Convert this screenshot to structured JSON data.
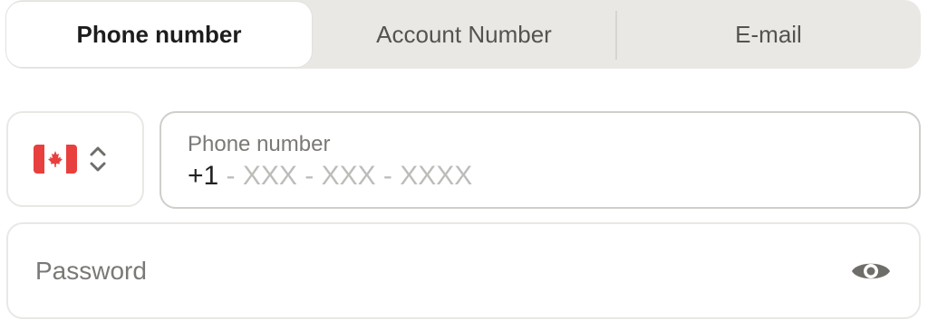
{
  "tabs": {
    "items": [
      {
        "label": "Phone number",
        "active": true
      },
      {
        "label": "Account Number",
        "active": false
      },
      {
        "label": "E-mail",
        "active": false
      }
    ]
  },
  "country_selector": {
    "flag_icon": "canada-flag-icon",
    "toggle_icon": "chevron-up-down-icon"
  },
  "phone_field": {
    "label": "Phone number",
    "country_code": "+1",
    "placeholder": " - XXX - XXX - XXXX"
  },
  "password_field": {
    "placeholder": "Password",
    "toggle_icon": "eye-icon"
  },
  "colors": {
    "tab_track": "#e9e8e4",
    "flag_red": "#e8403f",
    "icon_gray": "#6f6d69"
  }
}
